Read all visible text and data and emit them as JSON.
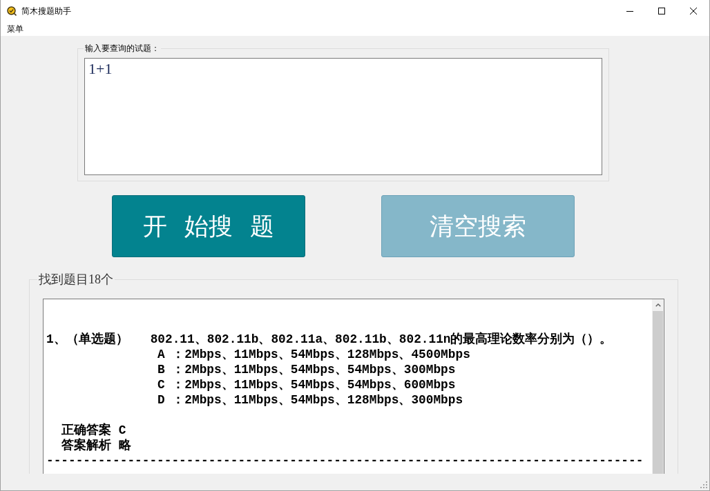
{
  "window": {
    "title": "简木搜题助手"
  },
  "menu_bar": {
    "items": [
      "菜单"
    ]
  },
  "query": {
    "label": "输入要查询的试题：",
    "value": "1+1"
  },
  "buttons": [
    {
      "label": "开 始搜 题",
      "kind": "primary"
    },
    {
      "label": "清空搜索",
      "kind": "secondary"
    }
  ],
  "results": {
    "label": "找到题目18个",
    "lines": [
      {
        "kind": "question",
        "text": "1、（单选题）   802.11、802.11b、802.11a、802.11b、802.11n的最高理论数率分别为（）。"
      },
      {
        "kind": "option",
        "text": "A ：2Mbps、11Mbps、54Mbps、128Mbps、4500Mbps"
      },
      {
        "kind": "option",
        "text": "B ：2Mbps、11Mbps、54Mbps、54Mbps、300Mbps"
      },
      {
        "kind": "option",
        "text": "C ：2Mbps、11Mbps、54Mbps、54Mbps、600Mbps"
      },
      {
        "kind": "option",
        "text": "D ：2Mbps、11Mbps、54Mbps、128Mbps、300Mbps"
      },
      {
        "kind": "answer",
        "text": "正确答案 C"
      },
      {
        "kind": "answer",
        "text": "答案解析 略"
      },
      {
        "kind": "separator",
        "text": "---------------------------------------------------------------------------------"
      }
    ]
  }
}
